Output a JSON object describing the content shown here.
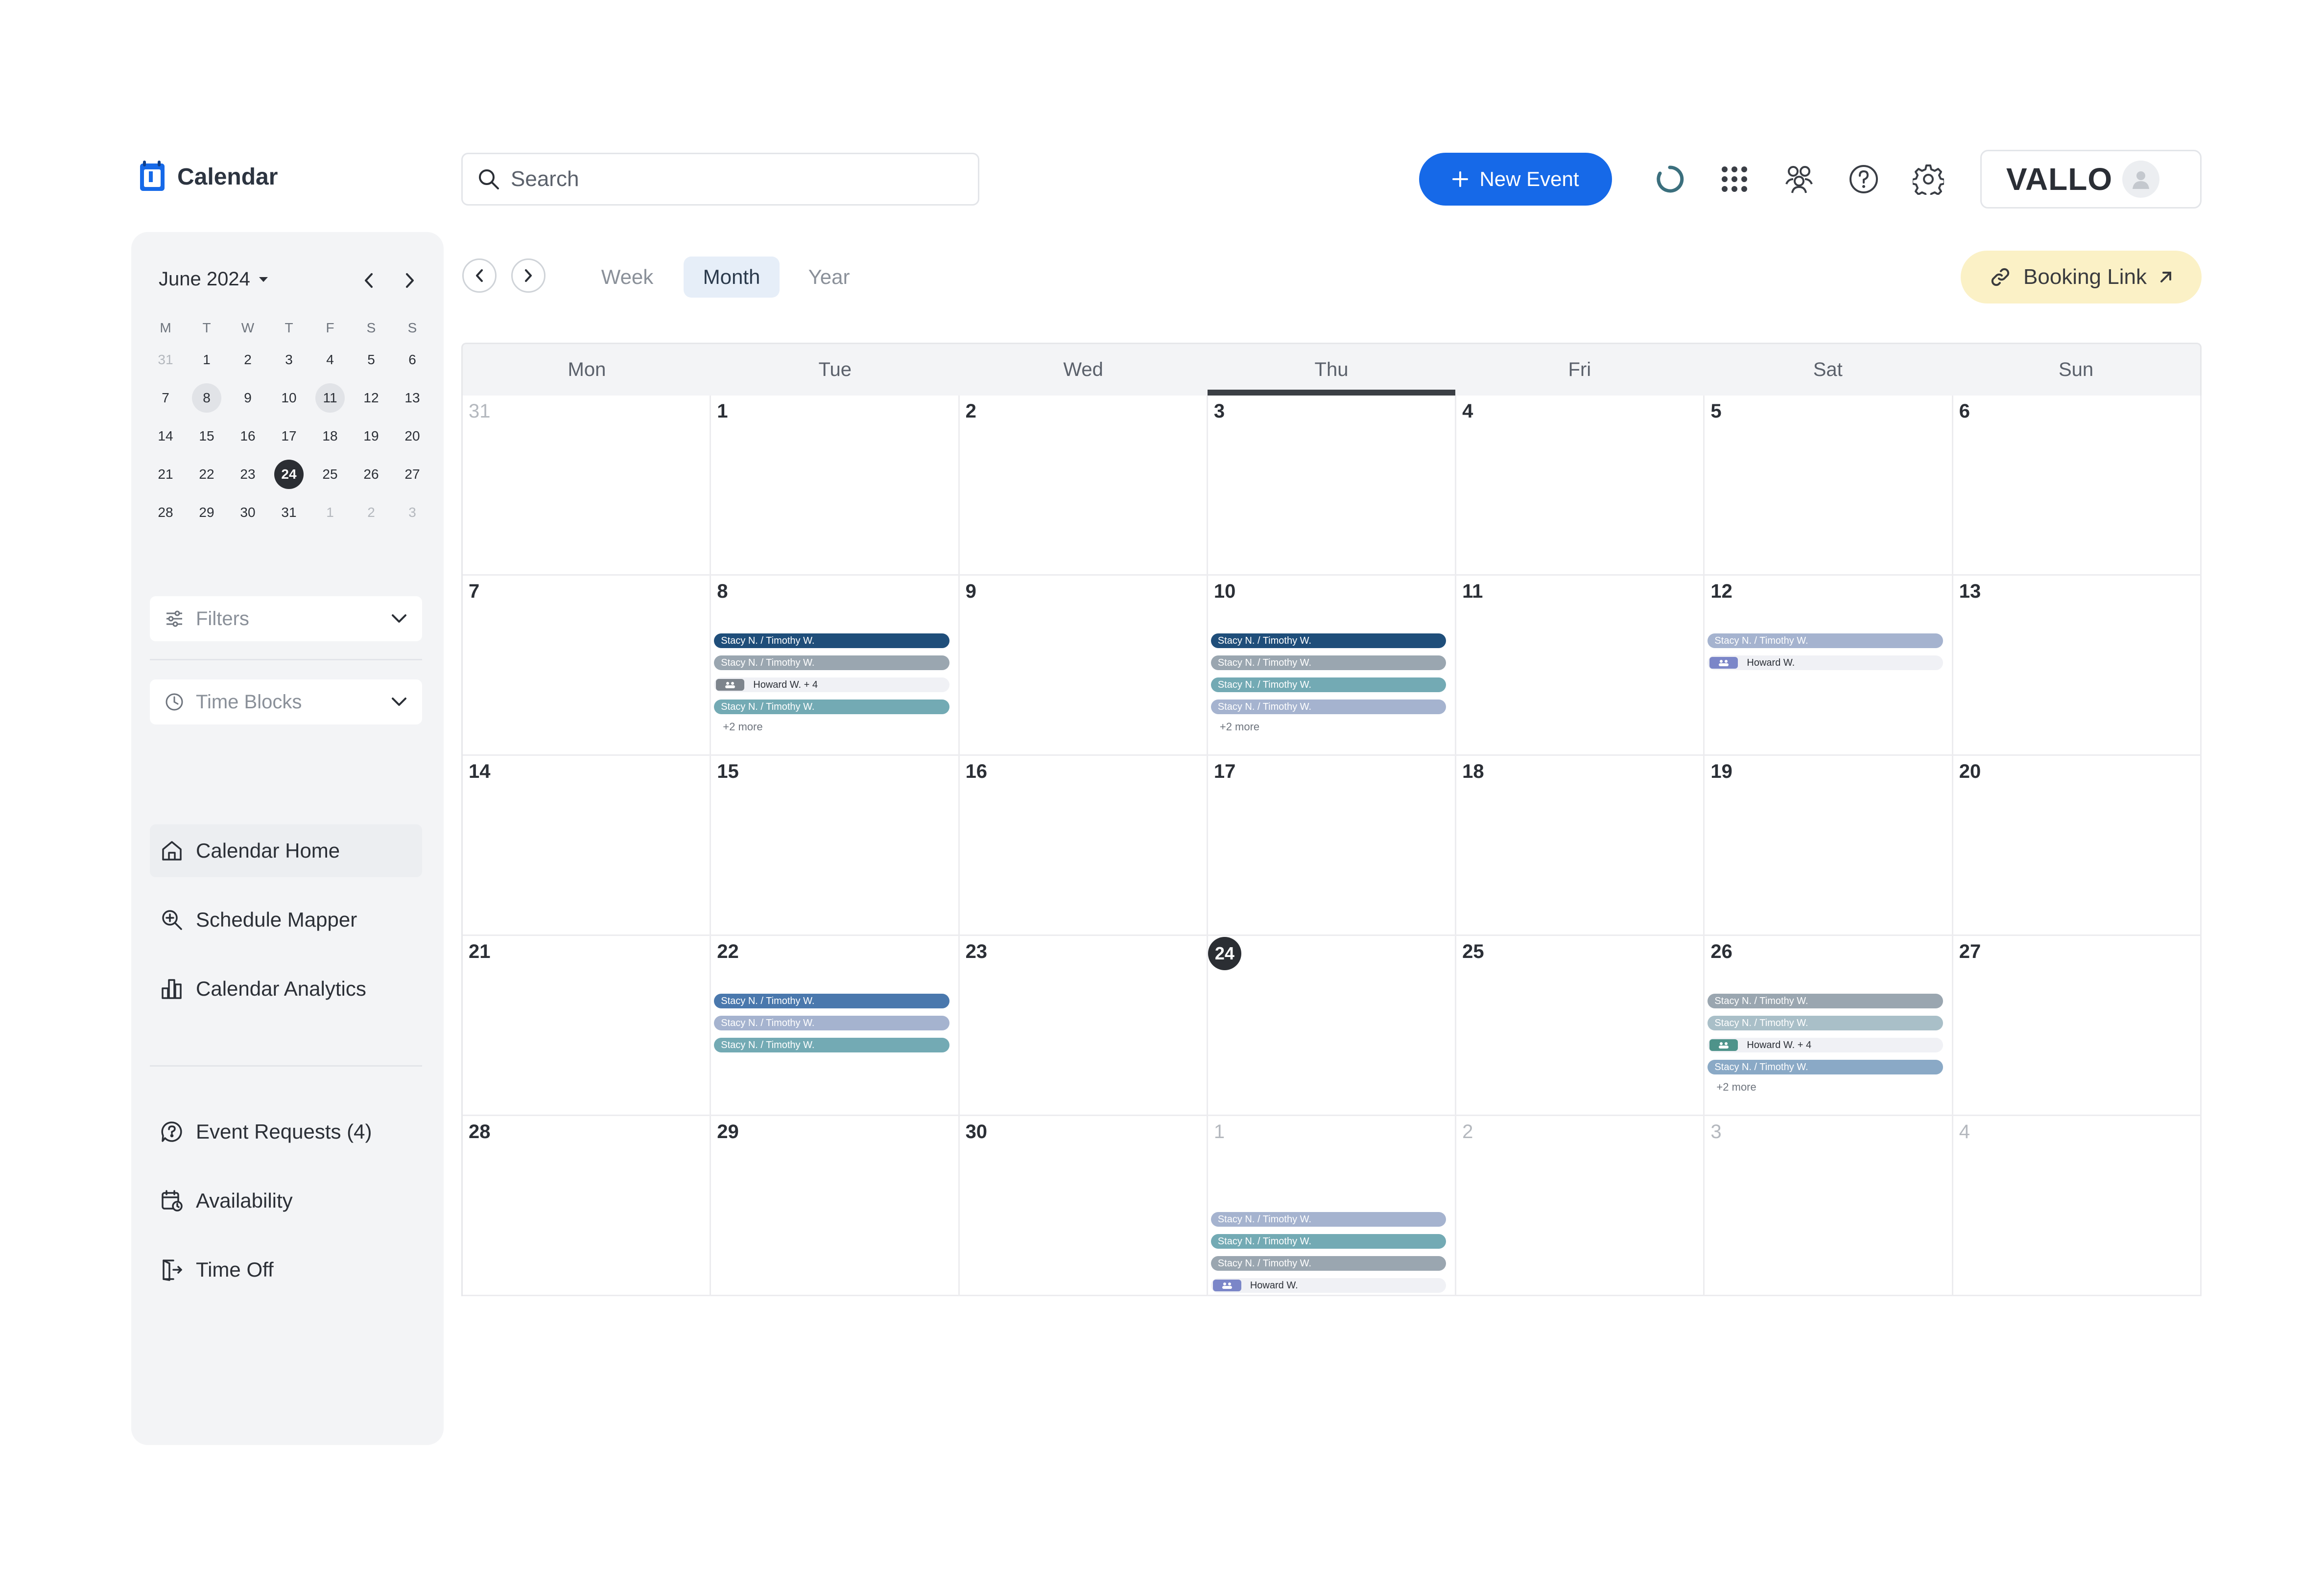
{
  "header": {
    "app_title": "Calendar",
    "search_placeholder": "Search",
    "new_event_label": "New Event",
    "brand": "VALLO",
    "icons": [
      "refresh-icon",
      "apps-grid-icon",
      "team-icon",
      "help-icon",
      "settings-icon",
      "user-avatar-icon"
    ]
  },
  "mini_calendar": {
    "month_label": "June 2024",
    "weekdays": [
      "M",
      "T",
      "W",
      "T",
      "F",
      "S",
      "S"
    ],
    "days": [
      {
        "d": "31",
        "muted": true
      },
      {
        "d": "1"
      },
      {
        "d": "2"
      },
      {
        "d": "3"
      },
      {
        "d": "4"
      },
      {
        "d": "5"
      },
      {
        "d": "6"
      },
      {
        "d": "7"
      },
      {
        "d": "8",
        "hl": true
      },
      {
        "d": "9"
      },
      {
        "d": "10"
      },
      {
        "d": "11",
        "hl": true
      },
      {
        "d": "12"
      },
      {
        "d": "13"
      },
      {
        "d": "14"
      },
      {
        "d": "15"
      },
      {
        "d": "16"
      },
      {
        "d": "17"
      },
      {
        "d": "18"
      },
      {
        "d": "19"
      },
      {
        "d": "20"
      },
      {
        "d": "21"
      },
      {
        "d": "22"
      },
      {
        "d": "23"
      },
      {
        "d": "24",
        "selected": true
      },
      {
        "d": "25"
      },
      {
        "d": "26"
      },
      {
        "d": "27"
      },
      {
        "d": "28"
      },
      {
        "d": "29"
      },
      {
        "d": "30"
      },
      {
        "d": "31"
      },
      {
        "d": "1",
        "muted": true
      },
      {
        "d": "2",
        "muted": true
      },
      {
        "d": "3",
        "muted": true
      }
    ]
  },
  "sidebar": {
    "filters_label": "Filters",
    "time_blocks_label": "Time Blocks",
    "nav_main": [
      {
        "label": "Calendar Home",
        "icon": "home-icon",
        "active": true
      },
      {
        "label": "Schedule Mapper",
        "icon": "search-zoom-icon"
      },
      {
        "label": "Calendar Analytics",
        "icon": "bar-chart-icon"
      }
    ],
    "nav_secondary": [
      {
        "label": "Event Requests (4)",
        "icon": "question-chat-icon"
      },
      {
        "label": "Availability",
        "icon": "calendar-clock-icon"
      },
      {
        "label": "Time Off",
        "icon": "door-exit-icon"
      }
    ]
  },
  "toolbar": {
    "views": [
      {
        "label": "Week"
      },
      {
        "label": "Month",
        "active": true
      },
      {
        "label": "Year"
      }
    ],
    "booking_link_label": "Booking Link"
  },
  "calendar": {
    "weekdays": [
      "Mon",
      "Tue",
      "Wed",
      "Thu",
      "Fri",
      "Sat",
      "Sun"
    ],
    "today_column": 3,
    "colors": {
      "navy": "#1f4e7a",
      "blue": "#4a78ad",
      "steel": "#8aa9c6",
      "grey": "#9aa6b0",
      "teal": "#73aab4",
      "lavender": "#a5b3cf",
      "team_bg": "#f0f1f5",
      "badge_grey": "#7d848c",
      "badge_purple": "#7b86c8",
      "badge_teal": "#4e938a"
    },
    "cells": [
      {
        "d": "31",
        "muted": true
      },
      {
        "d": "1"
      },
      {
        "d": "2"
      },
      {
        "d": "3"
      },
      {
        "d": "4"
      },
      {
        "d": "5"
      },
      {
        "d": "6"
      },
      {
        "d": "7"
      },
      {
        "d": "8",
        "events": [
          {
            "label": "Stacy N. / Timothy W.",
            "color": "#1f4e7a"
          },
          {
            "label": "Stacy N. / Timothy W.",
            "color": "#9aa6b0"
          },
          {
            "label": "Howard W. + 4",
            "team": true,
            "badge": "#7d848c"
          },
          {
            "label": "Stacy N. / Timothy W.",
            "color": "#73aab4"
          }
        ],
        "more": "+2 more"
      },
      {
        "d": "9"
      },
      {
        "d": "10",
        "events": [
          {
            "label": "Stacy N. / Timothy W.",
            "color": "#1f4e7a"
          },
          {
            "label": "Stacy N. / Timothy W.",
            "color": "#9aa6b0"
          },
          {
            "label": "Stacy N. / Timothy W.",
            "color": "#73aab4"
          },
          {
            "label": "Stacy N. / Timothy W.",
            "color": "#a5b3cf"
          }
        ],
        "more": "+2 more"
      },
      {
        "d": "11"
      },
      {
        "d": "12",
        "events": [
          {
            "label": "Stacy N. / Timothy W.",
            "color": "#a5b3cf"
          },
          {
            "label": "Howard W.",
            "team": true,
            "badge": "#7b86c8"
          }
        ]
      },
      {
        "d": "13"
      },
      {
        "d": "14"
      },
      {
        "d": "15"
      },
      {
        "d": "16"
      },
      {
        "d": "17"
      },
      {
        "d": "18"
      },
      {
        "d": "19"
      },
      {
        "d": "20"
      },
      {
        "d": "21"
      },
      {
        "d": "22",
        "events": [
          {
            "label": "Stacy N. / Timothy W.",
            "color": "#4a78ad"
          },
          {
            "label": "Stacy N. / Timothy W.",
            "color": "#a5b3cf"
          },
          {
            "label": "Stacy N. / Timothy W.",
            "color": "#73aab4"
          }
        ]
      },
      {
        "d": "23"
      },
      {
        "d": "24",
        "selected": true
      },
      {
        "d": "25"
      },
      {
        "d": "26",
        "events": [
          {
            "label": "Stacy N. / Timothy W.",
            "color": "#9aa6b0"
          },
          {
            "label": "Stacy N. / Timothy W.",
            "color": "#a9bfc8"
          },
          {
            "label": "Howard W. + 4",
            "team": true,
            "badge": "#4e938a"
          },
          {
            "label": "Stacy N. / Timothy W.",
            "color": "#8aa9c6"
          }
        ],
        "more": "+2 more"
      },
      {
        "d": "27"
      },
      {
        "d": "28"
      },
      {
        "d": "29"
      },
      {
        "d": "30"
      },
      {
        "d": "1",
        "muted": true,
        "offset": true,
        "events": [
          {
            "label": "Stacy N. / Timothy W.",
            "color": "#a5b3cf"
          },
          {
            "label": "Stacy N. / Timothy W.",
            "color": "#73aab4"
          },
          {
            "label": "Stacy N. / Timothy W.",
            "color": "#9aa6b0"
          },
          {
            "label": "Howard W.",
            "team": true,
            "badge": "#7b86c8"
          }
        ]
      },
      {
        "d": "2",
        "muted": true
      },
      {
        "d": "3",
        "muted": true
      },
      {
        "d": "4",
        "muted": true
      }
    ]
  }
}
